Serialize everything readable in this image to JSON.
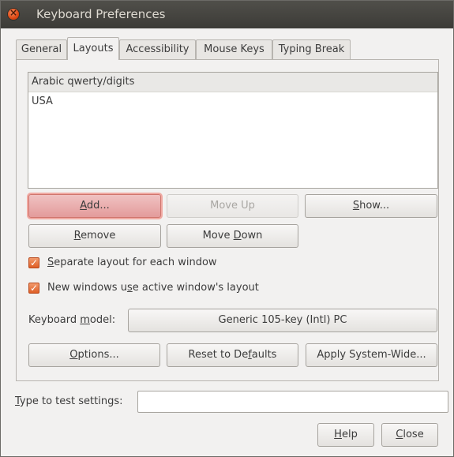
{
  "window": {
    "title": "Keyboard Preferences"
  },
  "tabs": [
    {
      "label": "General"
    },
    {
      "label": "Layouts"
    },
    {
      "label": "Accessibility"
    },
    {
      "label": "Mouse Keys"
    },
    {
      "label": "Typing Break"
    }
  ],
  "layouts": {
    "items": [
      "Arabic qwerty/digits",
      "USA"
    ],
    "selected_index": 0,
    "buttons": {
      "add": {
        "mnemonic": "A",
        "rest": "dd..."
      },
      "move_up": "Move Up",
      "show": {
        "mnemonic": "S",
        "rest": "how..."
      },
      "remove": {
        "mnemonic": "R",
        "rest": "emove"
      },
      "move_down": {
        "pre": "Move ",
        "mnemonic": "D",
        "rest": "own"
      },
      "options": {
        "mnemonic": "O",
        "rest": "ptions..."
      },
      "reset": {
        "pre": "Reset to De",
        "mnemonic": "f",
        "rest": "aults"
      },
      "apply": "Apply System-Wide..."
    },
    "checkboxes": {
      "separate": {
        "mnemonic": "S",
        "rest": "eparate layout for each window",
        "checked": true
      },
      "new_windows": {
        "pre": "New windows u",
        "mnemonic": "s",
        "rest": "e active window's layout",
        "checked": true
      }
    },
    "keyboard_model": {
      "pre": "Keyboard ",
      "mnemonic": "m",
      "rest": "odel:",
      "value": "Generic 105-key (Intl) PC"
    }
  },
  "test": {
    "pre": "",
    "mnemonic": "T",
    "rest": "ype to test settings:",
    "value": ""
  },
  "footer": {
    "help": {
      "mnemonic": "H",
      "rest": "elp"
    },
    "close": {
      "mnemonic": "C",
      "rest": "lose"
    }
  },
  "colors": {
    "accent": "#dd4814",
    "titlebar": "#3c3b37",
    "focus": "#e39b9b"
  }
}
